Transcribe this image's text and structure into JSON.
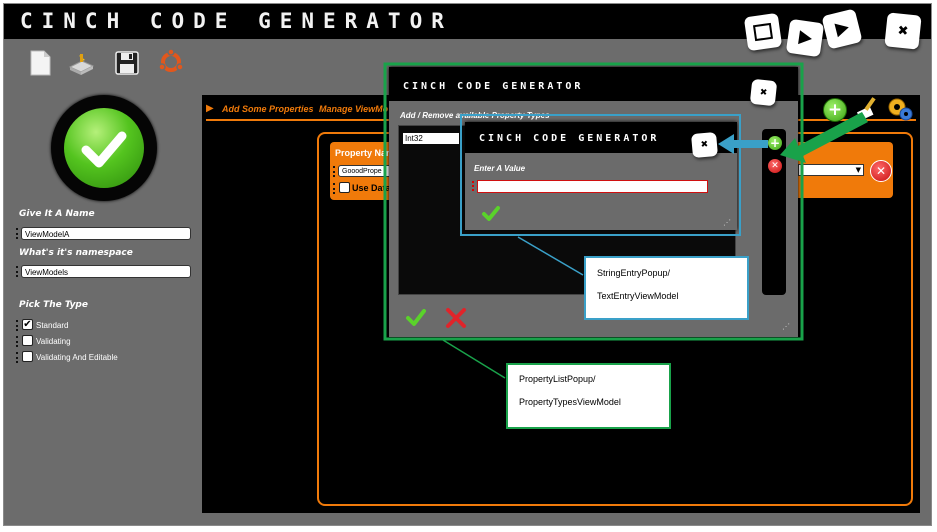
{
  "app": {
    "title": "CINCH CODE GENERATOR",
    "window_buttons": [
      "maximize-icon",
      "next-icon",
      "play-icon",
      "close-icon"
    ]
  },
  "toolbar": {
    "icons": [
      "new-file-icon",
      "open-drive-icon",
      "save-icon",
      "ubuntu-icon"
    ]
  },
  "left": {
    "name_label": "Give It A Name",
    "name_value": "ViewModelA",
    "namespace_label": "What's it's namespace",
    "namespace_value": "ViewModels",
    "type_label": "Pick The Type",
    "types": [
      {
        "label": "Standard",
        "checked": true
      },
      {
        "label": "Validating",
        "checked": false
      },
      {
        "label": "Validating And Editable",
        "checked": false
      }
    ]
  },
  "tabs": {
    "add_properties": "Add Some Properties",
    "manage_viewmodel": "Manage ViewMo"
  },
  "property_card": {
    "name_label": "Property Nar",
    "name_value": "GooodPrope",
    "use_data_label": "Use Data"
  },
  "property_list_popup": {
    "title": "CINCH CODE GENERATOR",
    "header": "Add / Remove available Property Types",
    "list_items": [
      "Int32"
    ]
  },
  "string_entry_popup": {
    "title": "CINCH CODE GENERATOR",
    "prompt": "Enter A Value",
    "value": ""
  },
  "annotations": {
    "string_entry": [
      "StringEntryPopup/",
      "TextEntryViewModel"
    ],
    "property_list": [
      "PropertyListPopup/",
      "PropertyTypesViewModel"
    ]
  },
  "colors": {
    "accent_orange": "#f07a0a",
    "annotation_green": "#19a24a",
    "annotation_blue": "#3aa0c8",
    "background_gray": "#6c6c6c"
  }
}
